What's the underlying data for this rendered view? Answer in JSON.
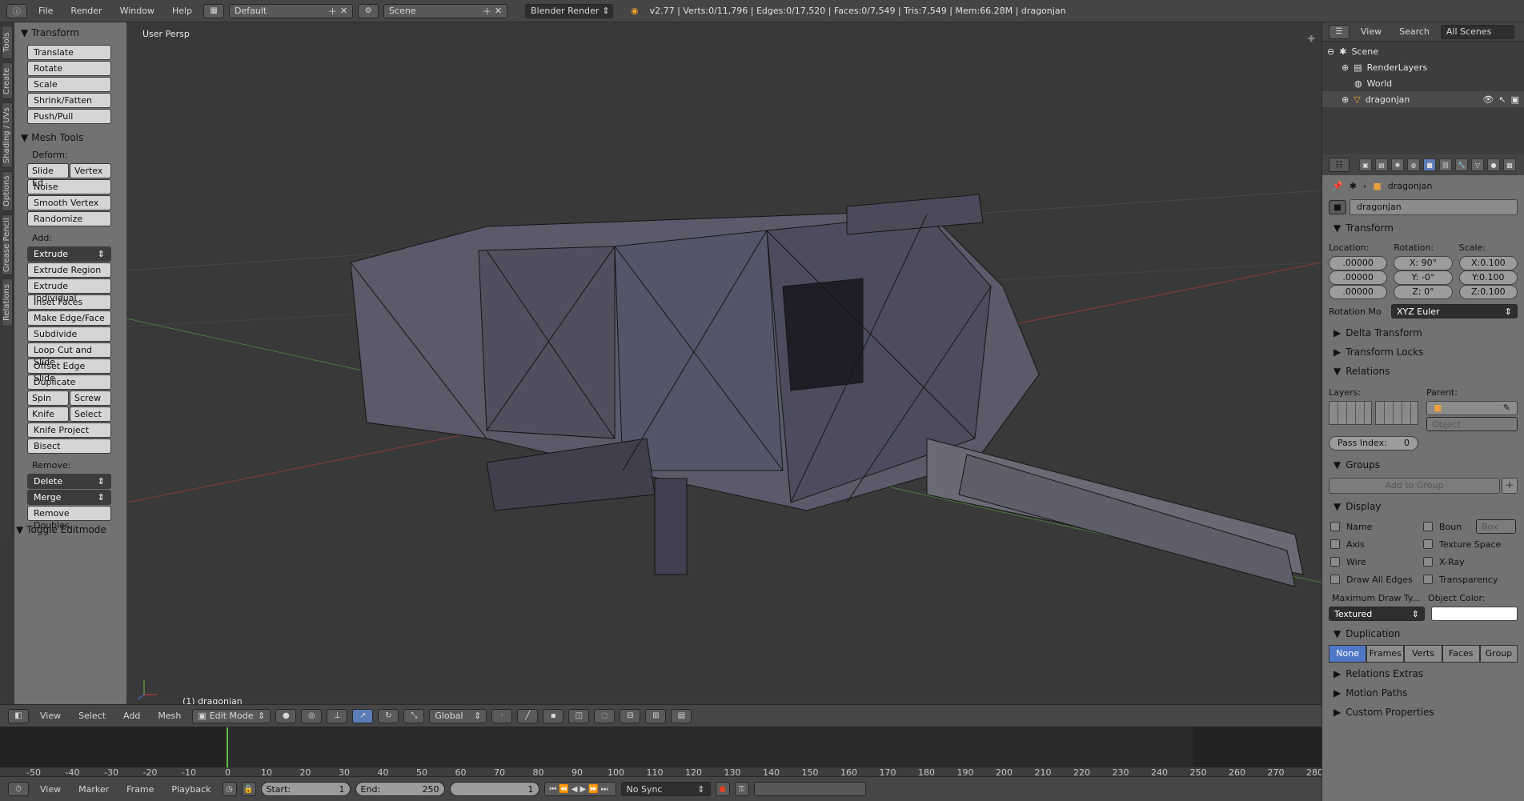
{
  "topbar": {
    "menus": [
      "File",
      "Render",
      "Window",
      "Help"
    ],
    "layout": "Default",
    "scene": "Scene",
    "engine": "Blender Render",
    "stats": "v2.77 | Verts:0/11,796 | Edges:0/17,520 | Faces:0/7,549 | Tris:7,549 | Mem:66.28M | dragonjan"
  },
  "lefttabs": [
    "Tools",
    "Create",
    "Shading / UVs",
    "Options",
    "Grease Pencil",
    "Relations"
  ],
  "tools": {
    "transform_head": "Transform",
    "transform": [
      "Translate",
      "Rotate",
      "Scale",
      "Shrink/Fatten",
      "Push/Pull"
    ],
    "meshtools_head": "Mesh Tools",
    "deform_label": "Deform:",
    "slide_edge": "Slide Ed",
    "vertex": "Vertex",
    "deform": [
      "Noise",
      "Smooth Vertex",
      "Randomize"
    ],
    "add_label": "Add:",
    "extrude": "Extrude",
    "add": [
      "Extrude Region",
      "Extrude Individual",
      "Inset Faces",
      "Make Edge/Face",
      "Subdivide",
      "Loop Cut and Slide",
      "Offset Edge Slide",
      "Duplicate"
    ],
    "spin": "Spin",
    "screw": "Screw",
    "knife": "Knife",
    "select": "Select",
    "knife_project": "Knife Project",
    "bisect": "Bisect",
    "remove_label": "Remove:",
    "delete": "Delete",
    "merge": "Merge",
    "remove_doubles": "Remove Doubles",
    "toggle_editmode": "Toggle Editmode"
  },
  "viewport": {
    "label": "User Persp",
    "object_label": "(1) dragonjan"
  },
  "vpheader": {
    "menus": [
      "View",
      "Select",
      "Add",
      "Mesh"
    ],
    "mode": "Edit Mode",
    "orientation": "Global"
  },
  "timeline": {
    "ticks": [
      "-50",
      "-40",
      "-30",
      "-20",
      "-10",
      "0",
      "10",
      "20",
      "30",
      "40",
      "50",
      "60",
      "70",
      "80",
      "90",
      "100",
      "110",
      "120",
      "130",
      "140",
      "150",
      "160",
      "170",
      "180",
      "190",
      "200",
      "210",
      "220",
      "230",
      "240",
      "250",
      "260",
      "270",
      "280"
    ],
    "current_frame": 1
  },
  "tlheader": {
    "menus": [
      "View",
      "Marker",
      "Frame",
      "Playback"
    ],
    "start_label": "Start:",
    "start": "1",
    "end_label": "End:",
    "end": "250",
    "frame": "1",
    "sync": "No Sync"
  },
  "outliner": {
    "menus": [
      "View",
      "Search"
    ],
    "all_scenes": "All Scenes",
    "rows": [
      "Scene",
      "RenderLayers",
      "World",
      "dragonjan"
    ]
  },
  "props": {
    "breadcrumb": "dragonjan",
    "name": "dragonjan",
    "transform_head": "Transform",
    "location_label": "Location:",
    "rotation_label": "Rotation:",
    "scale_label": "Scale:",
    "location": [
      ".00000",
      ".00000",
      ".00000"
    ],
    "rotation": [
      "X:   90°",
      "Y:   -0°",
      "Z:    0°"
    ],
    "scale": [
      "X:0.100",
      "Y:0.100",
      "Z:0.100"
    ],
    "rotation_mode_label": "Rotation Mo",
    "rotation_mode": "XYZ Euler",
    "delta": "Delta Transform",
    "locks": "Transform Locks",
    "relations": "Relations",
    "layers_label": "Layers:",
    "parent_label": "Parent:",
    "parent_type": "Object",
    "pass_index_label": "Pass Index:",
    "pass_index": "0",
    "groups": "Groups",
    "add_to_group": "Add to Group",
    "display": "Display",
    "display_checks": [
      "Name",
      "Axis",
      "Wire",
      "Draw All Edges"
    ],
    "display_checks_r": [
      "Boun",
      "Texture Space",
      "X-Ray",
      "Transparency"
    ],
    "bounds_type": "Box",
    "max_draw_label": "Maximum Draw Ty...",
    "object_color_label": "Object Color:",
    "max_draw": "Textured",
    "duplication": "Duplication",
    "dup_tabs": [
      "None",
      "Frames",
      "Verts",
      "Faces",
      "Group"
    ],
    "relations_extras": "Relations Extras",
    "motion_paths": "Motion Paths",
    "custom_props": "Custom Properties"
  }
}
